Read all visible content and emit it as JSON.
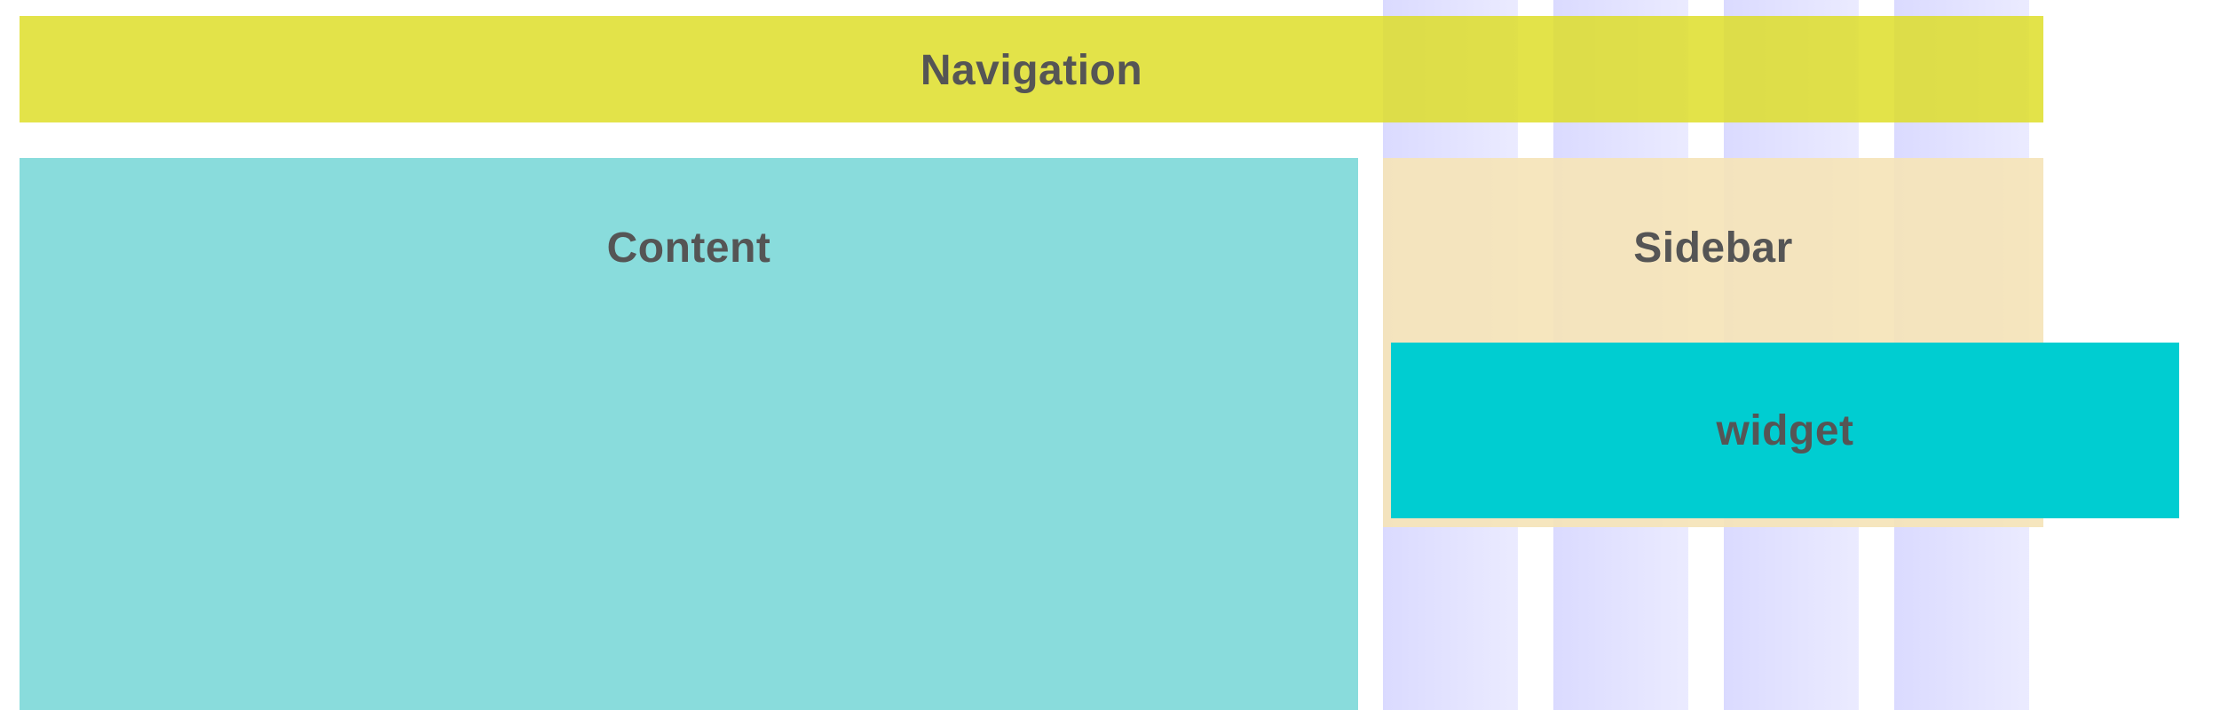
{
  "layout": {
    "navigation": {
      "label": "Navigation",
      "color": "#dddd21"
    },
    "content": {
      "label": "Content",
      "color": "#6fd4d4"
    },
    "sidebar": {
      "label": "Sidebar",
      "color": "#f5e4b8"
    },
    "widget": {
      "label": "widget",
      "color": "#00cdd1"
    }
  },
  "grid": {
    "column_count": 12,
    "column_color": "#dcdcff"
  }
}
